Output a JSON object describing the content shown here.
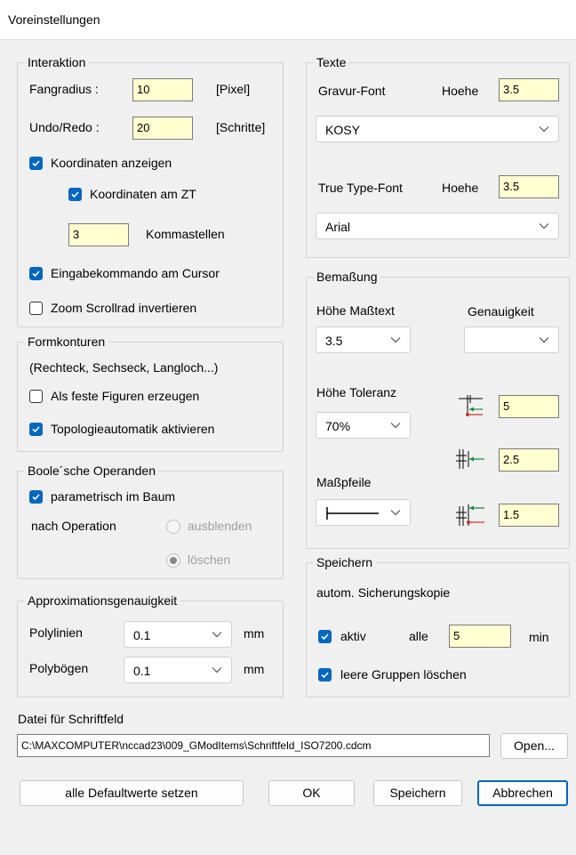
{
  "window": {
    "title": "Voreinstellungen"
  },
  "interaktion": {
    "legend": "Interaktion",
    "fangradius_label": "Fangradius :",
    "fangradius_value": "10",
    "fangradius_unit": "[Pixel]",
    "undo_label": "Undo/Redo :",
    "undo_value": "20",
    "undo_unit": "[Schritte]",
    "koordinaten_anzeigen": "Koordinaten anzeigen",
    "koordinaten_zt": "Koordinaten am ZT",
    "kommastellen_value": "3",
    "kommastellen_label": "Kommastellen",
    "eingabekommando": "Eingabekommando am Cursor",
    "zoom_scrollrad": "Zoom Scrollrad invertieren"
  },
  "formkonturen": {
    "legend": "Formkonturen",
    "hint": "(Rechteck, Sechseck, Langloch...)",
    "feste_figuren": "Als feste Figuren erzeugen",
    "topologie": "Topologieautomatik aktivieren"
  },
  "boole": {
    "legend": "Boole´sche Operanden",
    "parametrisch": "parametrisch im Baum",
    "nach_operation": "nach Operation",
    "ausblenden": "ausblenden",
    "loeschen": "löschen"
  },
  "approx": {
    "legend": "Approximationsgenauigkeit",
    "polylinien_label": "Polylinien",
    "polylinien_value": "0.1",
    "polylinien_unit": "mm",
    "polyboegen_label": "Polybögen",
    "polyboegen_value": "0.1",
    "polyboegen_unit": "mm"
  },
  "texte": {
    "legend": "Texte",
    "gravur_label": "Gravur-Font",
    "gravur_hoehe_label": "Hoehe",
    "gravur_hoehe_value": "3.5",
    "gravur_font": "KOSY",
    "truetype_label": "True Type-Font",
    "truetype_hoehe_label": "Hoehe",
    "truetype_hoehe_value": "3.5",
    "truetype_font": "Arial"
  },
  "bemassung": {
    "legend": "Bemaßung",
    "hoehe_masstext_label": "Höhe Maßtext",
    "hoehe_masstext_value": "3.5",
    "genauigkeit_label": "Genauigkeit",
    "genauigkeit_value": "",
    "hoehe_toleranz_label": "Höhe Toleranz",
    "hoehe_toleranz_value": "70%",
    "masspfeile_label": "Maßpfeile",
    "spacing_1_value": "5",
    "spacing_2_value": "2.5",
    "spacing_3_value": "1.5"
  },
  "speichern": {
    "legend": "Speichern",
    "sicherung_label": "autom. Sicherungskopie",
    "aktiv_label": "aktiv",
    "alle_label": "alle",
    "interval_value": "5",
    "min_label": "min",
    "leere_gruppen": "leere Gruppen löschen"
  },
  "schriftfeld": {
    "label": "Datei für Schriftfeld",
    "path": "C:\\MAXCOMPUTER\\nccad23\\009_GModItems\\Schriftfeld_ISO7200.cdcm",
    "open_button": "Open..."
  },
  "buttons": {
    "defaults": "alle Defaultwerte setzen",
    "ok": "OK",
    "speichern": "Speichern",
    "abbrechen": "Abbrechen"
  },
  "colors": {
    "accent": "#0067c0",
    "field_bg": "#ffffd0",
    "dialog_bg": "#f0f0f0"
  }
}
